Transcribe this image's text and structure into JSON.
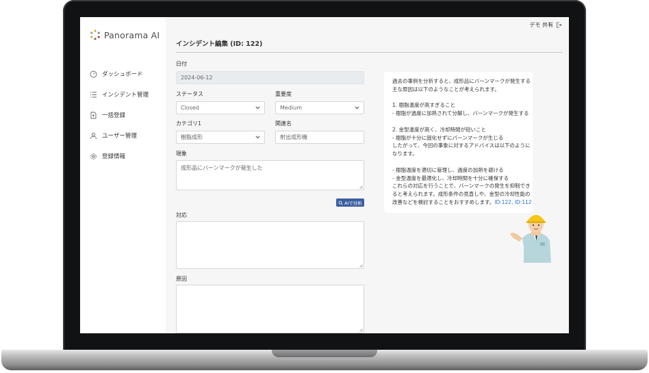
{
  "app": {
    "logo_text": "Panorama AI",
    "user": "デモ 共有"
  },
  "sidebar": {
    "items": [
      {
        "label": "ダッシュボード",
        "icon": "gauge-icon"
      },
      {
        "label": "インシデント管理",
        "icon": "list-icon"
      },
      {
        "label": "一括登録",
        "icon": "file-upload-icon"
      },
      {
        "label": "ユーザー管理",
        "icon": "user-icon"
      },
      {
        "label": "登録情報",
        "icon": "gear-icon"
      }
    ]
  },
  "page": {
    "title": "インシデント編集 (ID: 122)"
  },
  "form": {
    "date": {
      "label": "日付",
      "value": "2024-06-12"
    },
    "status": {
      "label": "ステータス",
      "value": "Closed"
    },
    "severity": {
      "label": "重要度",
      "value": "Medium"
    },
    "category": {
      "label": "カテゴリ1",
      "value": "樹脂成形"
    },
    "related": {
      "label": "関連名",
      "value": "射出成形機"
    },
    "phenomenon": {
      "label": "現象",
      "value": "成形品にバーンマークが発生した"
    },
    "ai_button": "AIで分析",
    "response": {
      "label": "対応",
      "value": ""
    },
    "cause": {
      "label": "原因",
      "value": ""
    }
  },
  "ai_panel": {
    "lines": [
      "過去の事例を分析すると、成形品にバーンマークが発生する",
      "主な原因は以下のようなことが考えられます。",
      "",
      "1. 樹脂温度が高すぎること",
      "- 樹脂が過度に加熱されて分解し、バーンマークが発生する",
      "",
      "2. 金型温度が高く、冷却時間が短いこと",
      "- 樹脂が十分に固化せずにバーンマークが生じる",
      "したがって、今回の事象に対するアドバイスは以下のように",
      "なります。",
      "",
      "- 樹脂温度を適切に管理し、過度の加熱を避ける",
      "- 金型温度を最適化し、冷却時間を十分に確保する",
      "これらの対応を行うことで、バーンマークの発生を抑制でき",
      "ると考えられます。成形条件の見直しや、金型の冷却性能の"
    ],
    "last_line": "改善などを検討することをおすすめします。",
    "refs": "ID:122, ID:112"
  }
}
